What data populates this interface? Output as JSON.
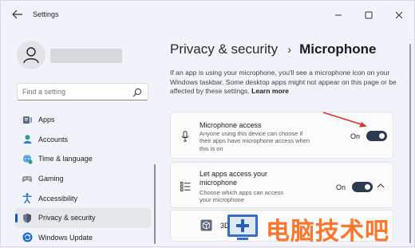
{
  "window": {
    "title": "Settings",
    "controls": [
      "—",
      "☐",
      "✕"
    ]
  },
  "sidebar": {
    "search_placeholder": "Find a setting",
    "items": [
      {
        "label": "Apps",
        "icon": "apps-icon"
      },
      {
        "label": "Accounts",
        "icon": "accounts-icon"
      },
      {
        "label": "Time & language",
        "icon": "globe-clock-icon"
      },
      {
        "label": "Gaming",
        "icon": "gamepad-icon"
      },
      {
        "label": "Accessibility",
        "icon": "accessibility-icon"
      },
      {
        "label": "Privacy & security",
        "icon": "shield-icon",
        "active": true
      },
      {
        "label": "Windows Update",
        "icon": "sync-icon"
      }
    ]
  },
  "main": {
    "breadcrumb_parent": "Privacy & security",
    "breadcrumb_sep": "›",
    "breadcrumb_current": "Microphone",
    "description": "If an app is using your microphone, you'll see a microphone icon on your Windows taskbar. Some desktop apps might not appear on this page or be affected by these settings.",
    "learn_more": "Learn more",
    "cards": [
      {
        "title": "Microphone access",
        "subtitle": "Anyone using this device can choose if their apps have microphone access when this is on",
        "state": "On"
      },
      {
        "title": "Let apps access your microphone",
        "subtitle": "Choose which apps can access your microphone",
        "state": "On"
      },
      {
        "title": "3D Viewer"
      }
    ]
  },
  "watermark": {
    "text": "电脑技术吧"
  },
  "colors": {
    "accent": "#0a58c9",
    "toggle_on": "#2b3a4e",
    "annotation_arrow": "#e0322b",
    "watermark": "#ff6a1a"
  }
}
